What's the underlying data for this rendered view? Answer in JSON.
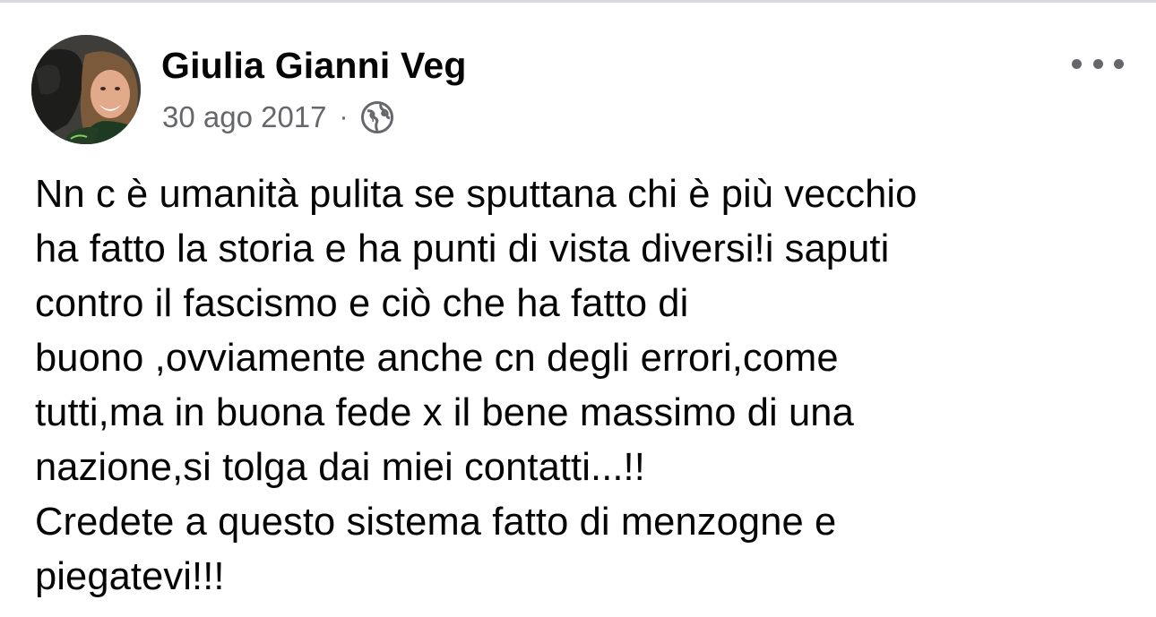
{
  "post": {
    "author": {
      "name": "Giulia Gianni Veg",
      "avatar_icon": "profile-photo"
    },
    "date": "30 ago 2017",
    "separator": "·",
    "audience_icon": "globe-icon",
    "more_icon": "more-horizontal-icon",
    "text": "Nn c è umanità pulita se sputtana chi è più vecchio\nha fatto la storia e ha punti di vista diversi!i saputi\ncontro il fascismo e ciò che ha fatto di\nbuono ,ovviamente anche cn degli errori,come\ntutti,ma in buona fede x il bene massimo di una\nnazione,si tolga dai miei contatti...!!\nCredete a questo sistema fatto di menzogne e\npiegatevi!!!"
  },
  "colors": {
    "text_primary": "#050505",
    "text_secondary": "#65676b",
    "background": "#ffffff",
    "divider": "#d8dadf"
  }
}
